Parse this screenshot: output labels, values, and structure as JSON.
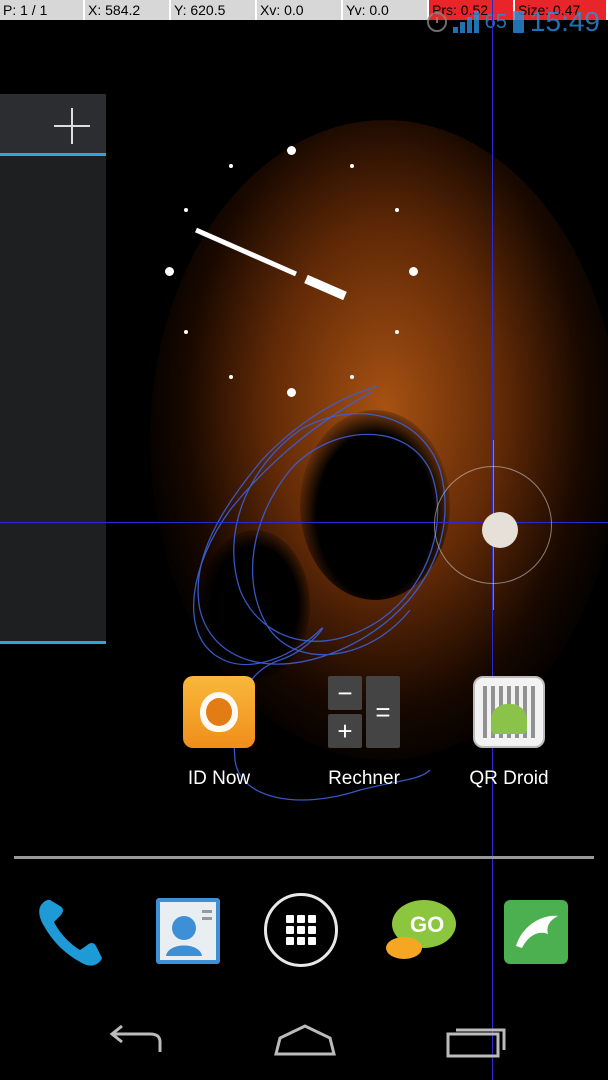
{
  "debug": {
    "pointer": "P: 1 / 1",
    "x": "X: 584.2",
    "y": "Y: 620.5",
    "xv": "Xv: 0.0",
    "yv": "Yv: 0.0",
    "prs": "Prs: 0.52",
    "size": "Size: 0.47"
  },
  "status_bar": {
    "battery_level": "65",
    "time": "15:49",
    "alarm_icon": "alarm-clock-icon",
    "signal_icon": "signal-bars-icon",
    "battery_icon": "battery-icon"
  },
  "widget_panel": {
    "add_icon": "plus-icon"
  },
  "apps": [
    {
      "label": "ID Now",
      "icon": "soundhound-icon"
    },
    {
      "label": "Rechner",
      "icon": "calculator-icon"
    },
    {
      "label": "QR Droid",
      "icon": "qr-droid-icon"
    }
  ],
  "calculator_keys": [
    "−",
    "=",
    "+",
    ""
  ],
  "dock": [
    {
      "icon": "phone-icon"
    },
    {
      "icon": "contacts-icon"
    },
    {
      "icon": "app-drawer-icon"
    },
    {
      "icon": "go-sms-icon"
    },
    {
      "icon": "dolphin-browser-icon"
    }
  ],
  "nav": [
    {
      "icon": "back-icon"
    },
    {
      "icon": "home-icon"
    },
    {
      "icon": "recent-apps-icon"
    }
  ],
  "colors": {
    "accent_blue": "#2fa6d9",
    "crosshair": "#2a2acf",
    "status_blue": "#2a8fe0",
    "debug_red": "#e8262a",
    "wallpaper_orange": "#c46016"
  }
}
